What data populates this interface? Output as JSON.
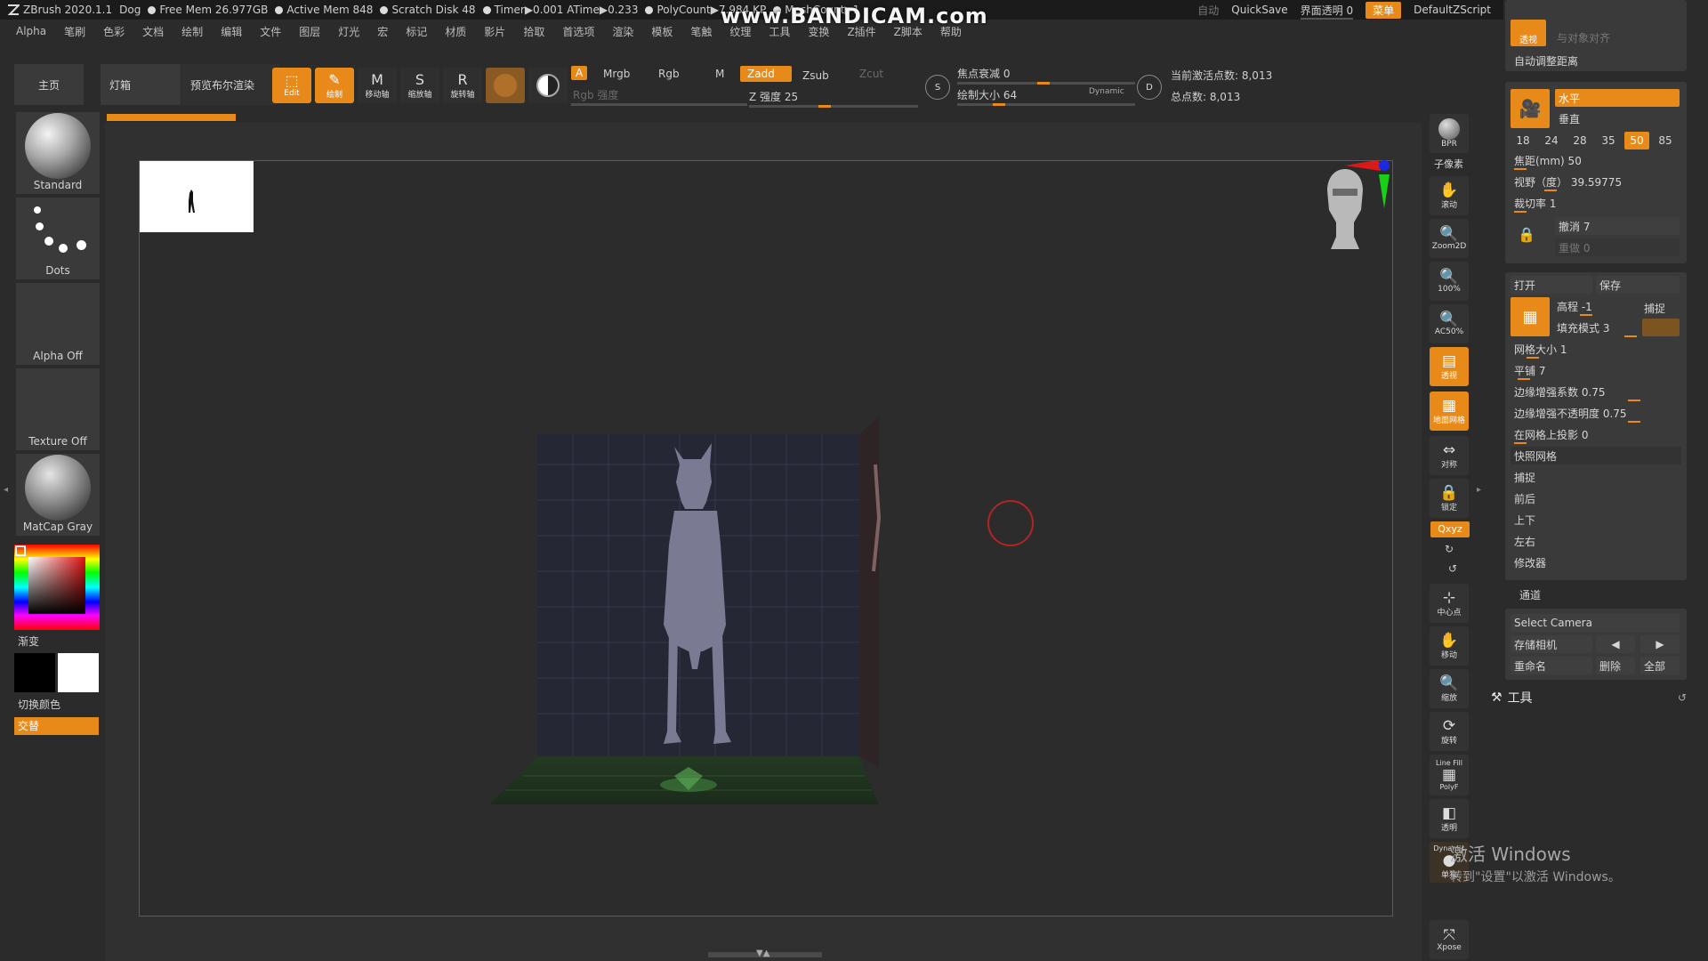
{
  "titlebar": {
    "app": "ZBrush 2020.1.1",
    "doc": "Dog",
    "free_mem": "Free Mem 26.977GB",
    "active_mem": "Active Mem 848",
    "scratch": "Scratch Disk 48",
    "timer": "Timer▶0.001 ATime▶0.233",
    "polycount": "PolyCount▶7.984 KP",
    "meshcount": "MeshCount▶1",
    "auto": "自动",
    "quicksave": "QuickSave",
    "ui_transparency": "界面透明 0",
    "menu_btn": "菜单",
    "script": "DefaultZScript"
  },
  "watermark_bandicam": "www.BANDICAM.com",
  "menubar": [
    "Alpha",
    "笔刷",
    "色彩",
    "文档",
    "绘制",
    "编辑",
    "文件",
    "图层",
    "灯光",
    "宏",
    "标记",
    "材质",
    "影片",
    "拾取",
    "首选项",
    "渲染",
    "模板",
    "笔触",
    "纹理",
    "工具",
    "变换",
    "Z插件",
    "Z脚本",
    "帮助"
  ],
  "shelf": {
    "tab_home": "主页",
    "tab_lightbox": "灯箱",
    "tab_bpr": "预览布尔渲染",
    "btn_edit": "Edit",
    "btn_draw": "绘制",
    "btn_move": "移动轴",
    "btn_scale": "缩放轴",
    "btn_rotate": "旋转轴",
    "a_chip": "A",
    "mrgb": "Mrgb",
    "rgb": "Rgb",
    "m": "M",
    "zadd": "Zadd",
    "zsub": "Zsub",
    "zcut": "Zcut",
    "rgb_intensity": "Rgb 强度",
    "z_intensity": "Z 强度 25",
    "focal_shift": "焦点衰减 0",
    "draw_size": "绘制大小 64",
    "dynamic": "Dynamic",
    "active_points": "当前激活点数: 8,013",
    "total_points": "总点数: 8,013"
  },
  "lefttray": {
    "brush": "Standard",
    "stroke": "Dots",
    "alpha": "Alpha Off",
    "texture": "Texture Off",
    "material": "MatCap Gray",
    "gradient": "渐变",
    "switch_color": "切换颜色",
    "alternate": "交替"
  },
  "rightcol": {
    "bpr": "BPR",
    "subpixel": "子像素",
    "scroll": "滚动",
    "zoom2d": "Zoom2D",
    "hundred": "100%",
    "ac50": "AC50%",
    "perspective": "透视",
    "floor": "地面网格",
    "local": "对称",
    "lock": "锁定",
    "xyz": "Qxyz",
    "center": "中心点",
    "move": "移动",
    "scale": "缩放",
    "rotate": "旋转",
    "linefill": "Line Fill",
    "polyf": "PolyF",
    "transp": "透明",
    "dynamic": "Dynamic",
    "solo": "单独",
    "xpose": "Xpose"
  },
  "rpanel": {
    "align_obj": "与对象对齐",
    "auto_adjust": "自动调整距离",
    "horizontal": "水平",
    "vertical": "垂直",
    "lens": [
      "18",
      "24",
      "28",
      "35",
      "50",
      "85"
    ],
    "lens_selected": "50",
    "focal_mm": "焦距(mm) 50",
    "fov": "视野（度） 39.59775",
    "clip": "裁切率 1",
    "undo": "撤消 7",
    "redo": "重做 0",
    "open": "打开",
    "save": "保存",
    "elevation": "高程 -1",
    "snap": "捕捉",
    "fill_mode": "填充模式 3",
    "grid_size": "网格大小 1",
    "tile": "平铺 7",
    "edge_boost": "边缘增强系数 0.75",
    "edge_opacity": "边缘增强不透明度 0.75",
    "project_grid": "在网格上投影 0",
    "quick_grid": "快照网格",
    "snap2": "捕捉",
    "front_back": "前后",
    "up_down": "上下",
    "left_right": "左右",
    "modifiers": "修改器",
    "channel": "通道",
    "select_camera": "Select Camera",
    "store_camera": "存储相机",
    "rename": "重命名",
    "delete": "删除",
    "all": "全部",
    "tool": "工具"
  },
  "win_watermark": {
    "line1": "激活 Windows",
    "line2": "转到\"设置\"以激活 Windows。"
  }
}
